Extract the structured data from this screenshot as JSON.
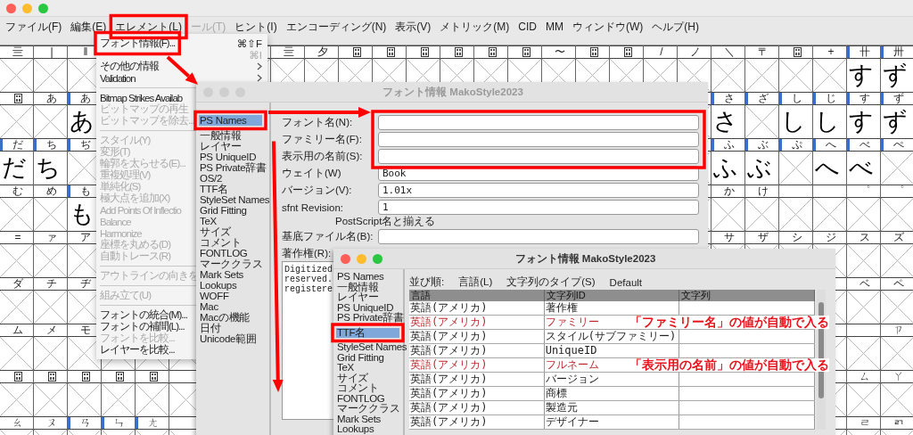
{
  "menu_bar": [
    {
      "label": "ファイル(F)",
      "disabled": false
    },
    {
      "label": "編集(E)",
      "disabled": false
    },
    {
      "label": "エレメント(L)",
      "disabled": false
    },
    {
      "label": "ール(T)",
      "disabled": true
    },
    {
      "label": "ヒント(I)",
      "disabled": false
    },
    {
      "label": "エンコーディング(N)",
      "disabled": false
    },
    {
      "label": "表示(V)",
      "disabled": false
    },
    {
      "label": "メトリック(M)",
      "disabled": false
    },
    {
      "label": "CID",
      "disabled": false
    },
    {
      "label": "MM",
      "disabled": false
    },
    {
      "label": "ウィンドウ(W)",
      "disabled": false
    },
    {
      "label": "ヘルプ(H)",
      "disabled": false
    }
  ],
  "element_menu": {
    "items": [
      {
        "kind": "item",
        "label": "フォント情報(F)...",
        "shortcut": "⌘⇧F",
        "disabled": false
      },
      {
        "kind": "item",
        "shortcut": "⌘I",
        "disabled": true
      },
      {
        "kind": "item",
        "label": "その他の情報",
        "submenu": true,
        "disabled": false
      },
      {
        "kind": "item",
        "label": "Validation",
        "submenu": true,
        "disabled": false
      },
      {
        "kind": "separator"
      },
      {
        "kind": "item",
        "label": "Bitmap Strikes Availab",
        "disabled": false
      },
      {
        "kind": "item",
        "label": "ビットマップの再生",
        "disabled": true
      },
      {
        "kind": "item",
        "label": "ビットマップを除去...",
        "disabled": true
      },
      {
        "kind": "separator"
      },
      {
        "kind": "item",
        "label": "スタイル(Y)",
        "disabled": true
      },
      {
        "kind": "item",
        "label": "変形(T)",
        "disabled": true
      },
      {
        "kind": "item",
        "label": "輪郭を太らせる(E)...",
        "disabled": true
      },
      {
        "kind": "item",
        "label": "重複処理(V)",
        "disabled": true
      },
      {
        "kind": "item",
        "label": "単純化(S)",
        "disabled": true
      },
      {
        "kind": "item",
        "label": "極大点を追加(X)",
        "disabled": true
      },
      {
        "kind": "item",
        "label": "Add Points Of Inflectio",
        "disabled": true
      },
      {
        "kind": "item",
        "label": "Balance",
        "disabled": true
      },
      {
        "kind": "item",
        "label": "Harmonize",
        "disabled": true
      },
      {
        "kind": "item",
        "label": "座標を丸める(D)",
        "disabled": true
      },
      {
        "kind": "item",
        "label": "自動トレース(R)",
        "disabled": true
      },
      {
        "kind": "separator"
      },
      {
        "kind": "item",
        "label": "アウトラインの向きを",
        "disabled": true
      },
      {
        "kind": "separator"
      },
      {
        "kind": "item",
        "label": "組み立て(U)",
        "disabled": true
      },
      {
        "kind": "separator"
      },
      {
        "kind": "item",
        "label": "フォントの統合(M)...",
        "disabled": false
      },
      {
        "kind": "item",
        "label": "フォントの補間(L)...",
        "disabled": false
      },
      {
        "kind": "item",
        "label": "フォントを比較...",
        "disabled": true
      },
      {
        "kind": "item",
        "label": "レイヤーを比較...",
        "disabled": false
      }
    ]
  },
  "glyph_grid": {
    "rows": [
      [
        {
          "label": "亖",
          "marked": false
        },
        {
          "label": "|",
          "marked": false
        },
        {
          "label": "‖",
          "marked": false
        },
        {},
        {},
        {},
        {},
        {},
        {
          "label": "亖",
          "marked": false
        },
        {
          "label": "夕",
          "marked": false
        },
        {
          "kind": "code"
        },
        {
          "kind": "code"
        },
        {
          "kind": "code"
        },
        {
          "kind": "code"
        },
        {
          "kind": "code"
        },
        {
          "kind": "code"
        },
        {
          "label": "〜",
          "marked": false
        },
        {
          "kind": "code"
        },
        {
          "kind": "code"
        },
        {
          "label": "/",
          "marked": false
        },
        {
          "label": "ノ",
          "marked": false
        },
        {
          "label": "＼",
          "marked": false
        },
        {
          "label": "〒",
          "marked": false
        },
        {
          "kind": "code"
        },
        {
          "label": "+",
          "marked": false
        },
        {
          "label": "卄",
          "marked": true,
          "glyph": "す"
        },
        {
          "label": "卅",
          "marked": true,
          "glyph": "ず"
        }
      ],
      [
        {
          "kind": "code"
        },
        {
          "label": "あ",
          "marked": false
        },
        {
          "label": "あ",
          "marked": true,
          "glyph": "あ"
        },
        {},
        {},
        {},
        {},
        {},
        {},
        {},
        {},
        {},
        {},
        {},
        {},
        {},
        {},
        {},
        {},
        {},
        {},
        {
          "label": "さ",
          "marked": true,
          "glyph": "さ"
        },
        {
          "label": "ざ",
          "marked": true
        },
        {
          "label": "し",
          "marked": true,
          "glyph": "し"
        },
        {
          "label": "じ",
          "marked": true,
          "glyph": "し"
        },
        {
          "label": "す",
          "marked": true,
          "glyph": "す"
        },
        {
          "label": "ず",
          "marked": true,
          "glyph": "ず"
        }
      ],
      [
        {
          "label": "だ",
          "marked": true,
          "glyph": "だ"
        },
        {
          "label": "ち",
          "marked": true,
          "glyph": "ち"
        },
        {
          "label": "ぢ",
          "marked": true
        },
        {},
        {},
        {},
        {},
        {},
        {},
        {},
        {},
        {},
        {},
        {},
        {},
        {},
        {},
        {},
        {},
        {},
        {},
        {
          "label": "ふ",
          "marked": true,
          "glyph": "ふ"
        },
        {
          "label": "ぶ",
          "marked": true,
          "glyph": "ぶ"
        },
        {
          "label": "ぷ",
          "marked": true
        },
        {
          "label": "へ",
          "marked": true,
          "glyph": "へ"
        },
        {
          "label": "べ",
          "marked": true,
          "glyph": "べ"
        },
        {
          "label": "ぺ",
          "marked": true
        }
      ],
      [
        {
          "label": "む",
          "marked": false
        },
        {
          "label": "め",
          "marked": false
        },
        {
          "label": "も",
          "marked": true,
          "glyph": "も"
        },
        {},
        {},
        {},
        {},
        {},
        {},
        {},
        {},
        {},
        {},
        {},
        {},
        {},
        {},
        {},
        {},
        {},
        {},
        {
          "label": "か",
          "marked": false
        },
        {
          "label": "け",
          "marked": false
        },
        {},
        {},
        {
          "label": "゜",
          "marked": false
        },
        {
          "label": "゜",
          "marked": false
        }
      ],
      [
        {
          "label": "=",
          "marked": false
        },
        {
          "label": "ァ",
          "marked": false
        },
        {
          "label": "ア",
          "marked": false
        },
        {},
        {},
        {},
        {},
        {},
        {},
        {},
        {},
        {},
        {},
        {},
        {},
        {},
        {},
        {},
        {},
        {},
        {},
        {
          "label": "サ",
          "marked": false
        },
        {
          "label": "ザ",
          "marked": false
        },
        {
          "label": "シ",
          "marked": false
        },
        {
          "label": "ジ",
          "marked": false
        },
        {
          "label": "ス",
          "marked": false
        },
        {
          "label": "ズ",
          "marked": false
        }
      ],
      [
        {
          "label": "ダ",
          "marked": false
        },
        {
          "label": "チ",
          "marked": false
        },
        {
          "label": "ヂ",
          "marked": false
        },
        {},
        {},
        {},
        {},
        {},
        {},
        {},
        {},
        {},
        {},
        {},
        {},
        {},
        {},
        {},
        {},
        {},
        {},
        {},
        {},
        {},
        {},
        {
          "label": "ベ",
          "marked": false
        },
        {
          "label": "ペ",
          "marked": false
        }
      ],
      [
        {
          "label": "ム",
          "marked": false
        },
        {
          "label": "メ",
          "marked": false
        },
        {
          "label": "モ",
          "marked": false
        },
        {},
        {},
        {},
        {},
        {},
        {},
        {},
        {},
        {},
        {},
        {},
        {},
        {},
        {},
        {},
        {},
        {},
        {},
        {},
        {},
        {},
        {},
        {},
        {
          "label": "ㄗ",
          "marked": false
        }
      ],
      [
        {
          "kind": "code"
        },
        {
          "kind": "code"
        },
        {
          "kind": "code"
        },
        {
          "kind": "code"
        },
        {
          "kind": "code"
        },
        {},
        {},
        {},
        {},
        {},
        {},
        {},
        {},
        {},
        {},
        {},
        {},
        {},
        {},
        {},
        {},
        {},
        {},
        {},
        {},
        {
          "label": "ㄙ",
          "marked": false
        },
        {
          "label": "ㄚ",
          "marked": false
        }
      ],
      [
        {
          "label": "ㄠ",
          "marked": false
        },
        {
          "label": "ㄡ",
          "marked": false
        },
        {
          "label": "ㄢ",
          "marked": true
        },
        {
          "label": "ㄣ",
          "marked": true
        },
        {
          "label": "ㄤ",
          "marked": true
        },
        {},
        {},
        {},
        {},
        {},
        {},
        {},
        {},
        {},
        {},
        {},
        {},
        {},
        {},
        {},
        {},
        {},
        {},
        {},
        {},
        {
          "label": "ㄹ",
          "marked": false
        },
        {
          "label": "ㄺ",
          "marked": false
        }
      ]
    ]
  },
  "font_info_dialog": {
    "title": "フォント情報 MakoStyle2023",
    "active": false,
    "categories": [
      {
        "label": "PS Names",
        "selected": true
      },
      {
        "label": "一般情報",
        "selected": false
      },
      {
        "label": "レイヤー",
        "selected": false
      },
      {
        "label": "PS UniqueID",
        "selected": false
      },
      {
        "label": "PS Private辞書",
        "selected": false
      },
      {
        "label": "OS/2",
        "selected": false
      },
      {
        "label": "TTF名",
        "selected": false
      },
      {
        "label": "StyleSet Names",
        "selected": false
      },
      {
        "label": "Grid Fitting",
        "selected": false
      },
      {
        "label": "TeX",
        "selected": false
      },
      {
        "label": "サイズ",
        "selected": false
      },
      {
        "label": "コメント",
        "selected": false
      },
      {
        "label": "FONTLOG",
        "selected": false
      },
      {
        "label": "マーククラス",
        "selected": false
      },
      {
        "label": "Mark Sets",
        "selected": false
      },
      {
        "label": "Lookups",
        "selected": false
      },
      {
        "label": "WOFF",
        "selected": false
      },
      {
        "label": "Mac",
        "selected": false
      },
      {
        "label": "Macの機能",
        "selected": false
      },
      {
        "label": "日付",
        "selected": false
      },
      {
        "label": "Unicode範囲",
        "selected": false
      }
    ],
    "fields": [
      {
        "kind": "field",
        "label": "フォント名(N):"
      },
      {
        "kind": "field",
        "label": "ファミリー名(F):"
      },
      {
        "kind": "field",
        "label": "表示用の名前(S):"
      },
      {
        "kind": "field",
        "label": "ウェイト(W)",
        "value": "Book"
      },
      {
        "kind": "field",
        "label": "バージョン(V):",
        "value": "1.01x"
      },
      {
        "kind": "field",
        "label": "sfnt Revision:",
        "value": "1"
      },
      {
        "kind": "caption",
        "label": "PostScript名と揃える"
      },
      {
        "kind": "field",
        "label": "基底ファイル名(B):"
      },
      {
        "kind": "textarea",
        "label": "著作権(R):",
        "lines": [
          "Digitized",
          "reserved.",
          "registere"
        ]
      }
    ]
  },
  "ttf_names_dialog": {
    "title": "フォント情報 MakoStyle2023",
    "active": true,
    "categories": [
      {
        "label": "PS Names",
        "selected": false
      },
      {
        "label": "一般情報",
        "selected": false
      },
      {
        "label": "レイヤー",
        "selected": false
      },
      {
        "label": "PS UniqueID",
        "selected": false
      },
      {
        "label": "PS Private辞書",
        "selected": false
      },
      {
        "label": "TTF名",
        "selected": true
      },
      {
        "label": "StyleSet Names",
        "selected": false
      },
      {
        "label": "Grid Fitting",
        "selected": false
      },
      {
        "label": "TeX",
        "selected": false
      },
      {
        "label": "サイズ",
        "selected": false
      },
      {
        "label": "コメント",
        "selected": false
      },
      {
        "label": "FONTLOG",
        "selected": false
      },
      {
        "label": "マーククラス",
        "selected": false
      },
      {
        "label": "Mark Sets",
        "selected": false
      },
      {
        "label": "Lookups",
        "selected": false
      }
    ],
    "sort_bar": [
      "並び順:",
      "言語(L)",
      "文字列のタイプ(S)",
      "Default"
    ],
    "table": {
      "columns": [
        "言語",
        "文字列ID",
        "文字列"
      ],
      "rows": [
        {
          "language": "英語(アメリカ)",
          "string_id": "著作権",
          "derived": false
        },
        {
          "language": "英語(アメリカ)",
          "string_id": "ファミリー",
          "derived": true
        },
        {
          "language": "英語(アメリカ)",
          "string_id": "スタイル(サブファミリー)",
          "derived": false
        },
        {
          "language": "英語(アメリカ)",
          "string_id": "UniqueID",
          "derived": false
        },
        {
          "language": "英語(アメリカ)",
          "string_id": "フルネーム",
          "derived": true
        },
        {
          "language": "英語(アメリカ)",
          "string_id": "バージョン",
          "derived": false
        },
        {
          "language": "英語(アメリカ)",
          "string_id": "商標",
          "derived": false
        },
        {
          "language": "英語(アメリカ)",
          "string_id": "製造元",
          "derived": false
        },
        {
          "language": "英語(アメリカ)",
          "string_id": "デザイナー",
          "derived": false
        }
      ]
    }
  },
  "callouts": [
    {
      "text": "「ファミリー名」の値が自動で入る"
    },
    {
      "text": "「表示用の名前」の値が自動で入る"
    }
  ]
}
